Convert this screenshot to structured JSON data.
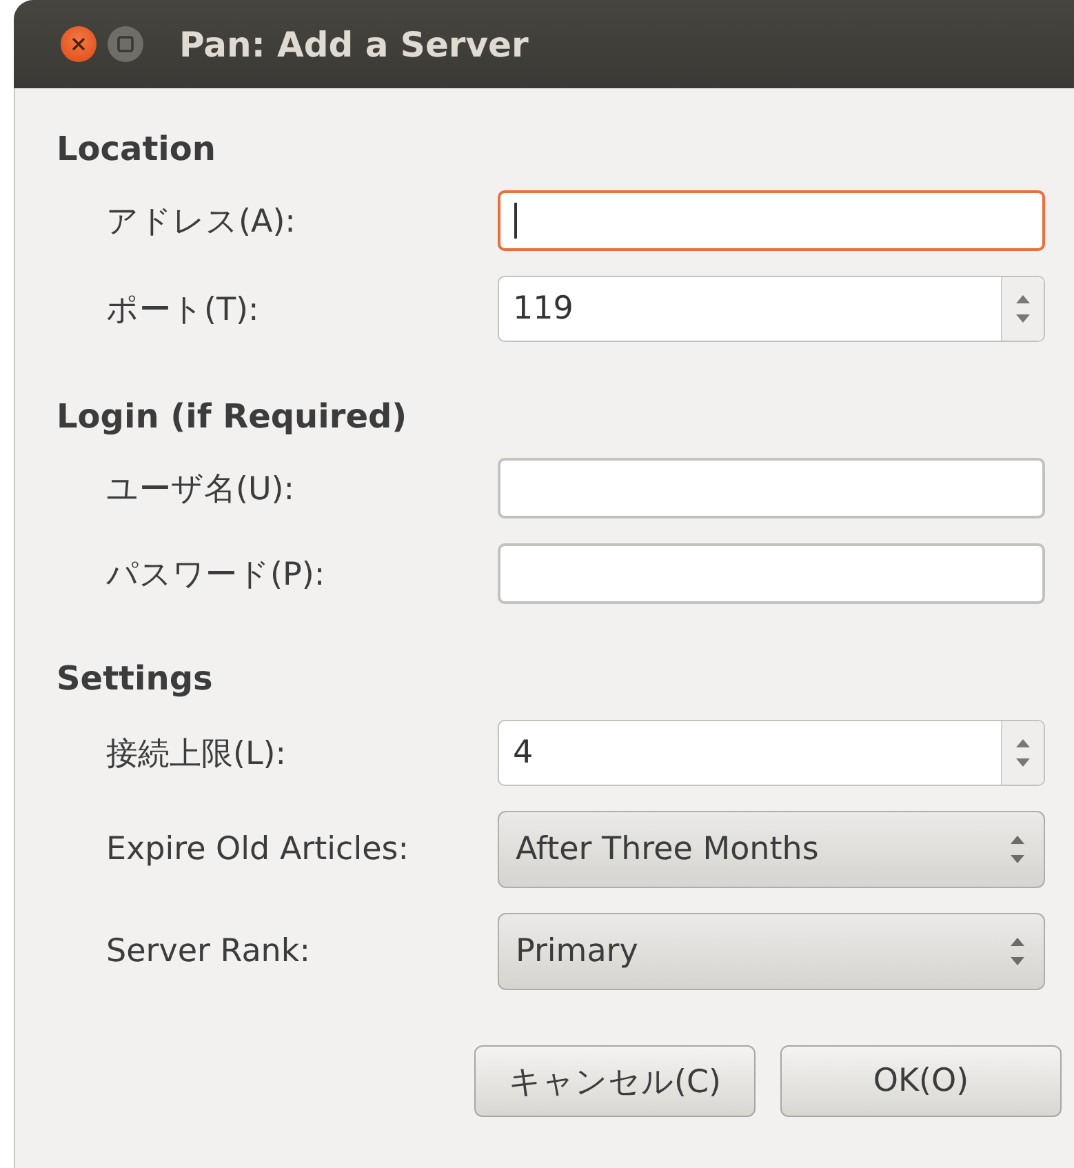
{
  "window": {
    "title": "Pan: Add a Server"
  },
  "sections": [
    {
      "title": "Location",
      "fields": [
        {
          "label": "アドレス(A):",
          "kind": "text",
          "focused": true
        },
        {
          "label": "ポート(T):",
          "kind": "spin",
          "value": "119",
          "focused": false
        }
      ]
    },
    {
      "title": "Login (if Required)",
      "fields": [
        {
          "label": "ユーザ名(U):",
          "kind": "text",
          "focused": false
        },
        {
          "label": "パスワード(P):",
          "kind": "text",
          "focused": false
        }
      ]
    },
    {
      "title": "Settings",
      "fields": [
        {
          "label": "接続上限(L):",
          "kind": "spin",
          "value": "4",
          "focused": false
        },
        {
          "label": "Expire Old Articles:",
          "kind": "combo",
          "value": "After Three Months",
          "focused": false
        },
        {
          "label": "Server Rank:",
          "kind": "combo",
          "value": "Primary",
          "focused": false
        }
      ]
    }
  ],
  "buttons": [
    "キャンセル(C)",
    "OK(O)"
  ]
}
